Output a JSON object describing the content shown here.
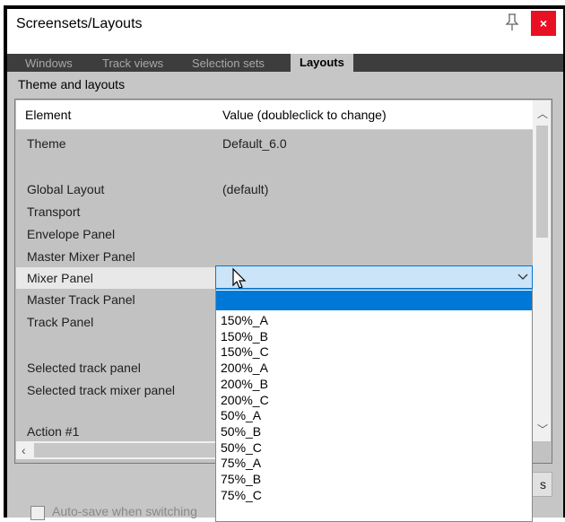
{
  "window": {
    "title": "Screensets/Layouts"
  },
  "tabs": [
    {
      "label": "Windows"
    },
    {
      "label": "Track views"
    },
    {
      "label": "Selection sets"
    },
    {
      "label": "Layouts",
      "active": true
    }
  ],
  "section": {
    "label": "Theme and layouts"
  },
  "table": {
    "columns": [
      "Element",
      "Value (doubleclick to change)"
    ],
    "rows": [
      {
        "label": "Theme",
        "value": "Default_6.0"
      },
      {
        "label": "Global Layout",
        "value": "(default)"
      },
      {
        "label": "Transport",
        "value": ""
      },
      {
        "label": "Envelope Panel",
        "value": ""
      },
      {
        "label": "Master Mixer Panel",
        "value": ""
      },
      {
        "label": "Mixer Panel",
        "value": ""
      },
      {
        "label": "Master Track Panel",
        "value": ""
      },
      {
        "label": "Track Panel",
        "value": ""
      },
      {
        "label": "Selected track panel",
        "value": ""
      },
      {
        "label": "Selected track mixer panel",
        "value": ""
      },
      {
        "label": "Action #1",
        "value": ""
      }
    ]
  },
  "dropdown": {
    "options": [
      "150%_A",
      "150%_B",
      "150%_C",
      "200%_A",
      "200%_B",
      "200%_C",
      "50%_A",
      "50%_B",
      "50%_C",
      "75%_A",
      "75%_B",
      "75%_C"
    ]
  },
  "button": {
    "label": "s"
  },
  "checkbox": {
    "label": "Auto-save when switching"
  },
  "colors": {
    "accent": "#0078d7",
    "close": "#e81123",
    "tab_bar": "#3d3d3d"
  }
}
